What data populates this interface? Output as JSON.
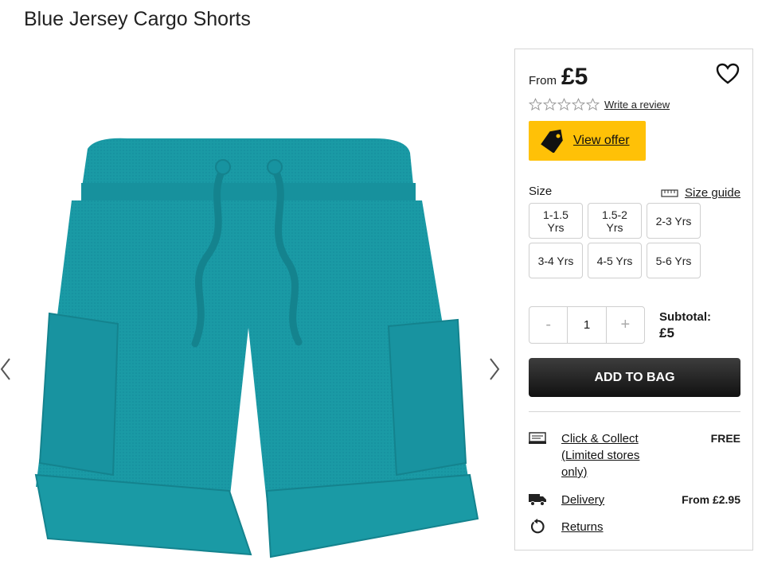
{
  "product": {
    "title": "Blue Jersey Cargo Shorts",
    "color": "#1a9aa5"
  },
  "gallery": {
    "prev_icon": "chevron-left-icon",
    "next_icon": "chevron-right-icon"
  },
  "pricing": {
    "from_label": "From",
    "price": "£5"
  },
  "rating": {
    "stars": 0,
    "max_stars": 5,
    "review_link": "Write a review"
  },
  "offer": {
    "label": "View offer",
    "icon": "tag-icon",
    "color": "#ffc107"
  },
  "size": {
    "label": "Size",
    "guide_label": "Size guide",
    "options": [
      "1-1.5 Yrs",
      "1.5-2 Yrs",
      "2-3 Yrs",
      "3-4 Yrs",
      "4-5 Yrs",
      "5-6 Yrs"
    ]
  },
  "quantity": {
    "minus": "-",
    "value": "1",
    "plus": "+"
  },
  "subtotal": {
    "label": "Subtotal:",
    "value": "£5"
  },
  "add_to_bag": {
    "label": "ADD TO BAG"
  },
  "delivery": [
    {
      "icon": "click-collect-icon",
      "label": "Click & Collect (Limited stores only)",
      "price": "FREE"
    },
    {
      "icon": "delivery-truck-icon",
      "label": "Delivery",
      "price": "From £2.95"
    },
    {
      "icon": "returns-icon",
      "label": "Returns",
      "price": ""
    }
  ]
}
